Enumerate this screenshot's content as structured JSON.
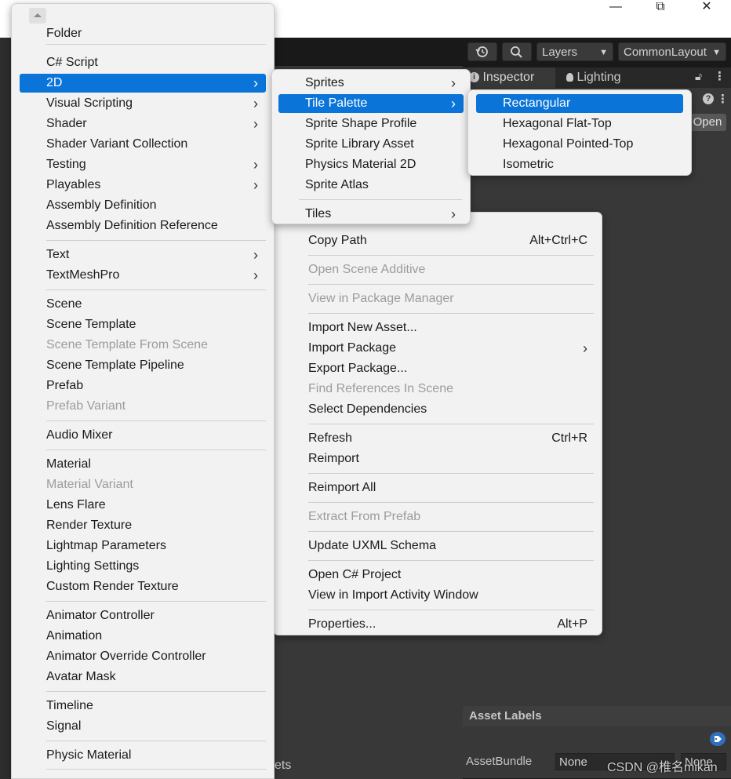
{
  "window": {
    "minimize_glyph": "—",
    "restore_glyph": "⧉",
    "close_glyph": "✕"
  },
  "toolbar": {
    "history_icon": "history-icon",
    "search_icon": "search-icon",
    "layers_label": "Layers",
    "layout_label": "CommonLayout"
  },
  "inspector": {
    "tabs": [
      "Inspector",
      "Lighting"
    ],
    "open_label": "Open",
    "asset_labels_title": "Asset Labels",
    "assetbundle_label": "AssetBundle",
    "assetbundle_value": "None",
    "assetbundle_variant": "None",
    "bottom_partial_text": "ets"
  },
  "create_menu": {
    "items": [
      {
        "label": "Folder"
      },
      {
        "label": "C# Script"
      },
      {
        "label": "2D",
        "submenu": true,
        "selected": true
      },
      {
        "label": "Visual Scripting",
        "submenu": true
      },
      {
        "label": "Shader",
        "submenu": true
      },
      {
        "label": "Shader Variant Collection"
      },
      {
        "label": "Testing",
        "submenu": true
      },
      {
        "label": "Playables",
        "submenu": true
      },
      {
        "label": "Assembly Definition"
      },
      {
        "label": "Assembly Definition Reference"
      },
      {
        "label": "Text",
        "submenu": true
      },
      {
        "label": "TextMeshPro",
        "submenu": true
      },
      {
        "label": "Scene"
      },
      {
        "label": "Scene Template"
      },
      {
        "label": "Scene Template From Scene",
        "disabled": true
      },
      {
        "label": "Scene Template Pipeline"
      },
      {
        "label": "Prefab"
      },
      {
        "label": "Prefab Variant",
        "disabled": true
      },
      {
        "label": "Audio Mixer"
      },
      {
        "label": "Material"
      },
      {
        "label": "Material Variant",
        "disabled": true
      },
      {
        "label": "Lens Flare"
      },
      {
        "label": "Render Texture"
      },
      {
        "label": "Lightmap Parameters"
      },
      {
        "label": "Lighting Settings"
      },
      {
        "label": "Custom Render Texture"
      },
      {
        "label": "Animator Controller"
      },
      {
        "label": "Animation"
      },
      {
        "label": "Animator Override Controller"
      },
      {
        "label": "Avatar Mask"
      },
      {
        "label": "Timeline"
      },
      {
        "label": "Signal"
      },
      {
        "label": "Physic Material"
      }
    ]
  },
  "menu_2d": {
    "items": [
      {
        "label": "Sprites",
        "submenu": true
      },
      {
        "label": "Tile Palette",
        "submenu": true,
        "selected": true
      },
      {
        "label": "Sprite Shape Profile"
      },
      {
        "label": "Sprite Library Asset"
      },
      {
        "label": "Physics Material 2D"
      },
      {
        "label": "Sprite Atlas"
      },
      {
        "label": "Tiles",
        "submenu": true
      }
    ]
  },
  "menu_tile_palette": {
    "items": [
      {
        "label": "Rectangular",
        "selected": true
      },
      {
        "label": "Hexagonal Flat-Top"
      },
      {
        "label": "Hexagonal Pointed-Top"
      },
      {
        "label": "Isometric"
      }
    ]
  },
  "context_menu": {
    "items": [
      {
        "label": "Copy Path",
        "shortcut": "Alt+Ctrl+C"
      },
      {
        "label": "Open Scene Additive",
        "disabled": true
      },
      {
        "label": "View in Package Manager",
        "disabled": true
      },
      {
        "label": "Import New Asset..."
      },
      {
        "label": "Import Package",
        "submenu": true
      },
      {
        "label": "Export Package..."
      },
      {
        "label": "Find References In Scene",
        "disabled": true
      },
      {
        "label": "Select Dependencies"
      },
      {
        "label": "Refresh",
        "shortcut": "Ctrl+R"
      },
      {
        "label": "Reimport"
      },
      {
        "label": "Reimport All"
      },
      {
        "label": "Extract From Prefab",
        "disabled": true
      },
      {
        "label": "Update UXML Schema"
      },
      {
        "label": "Open C# Project"
      },
      {
        "label": "View in Import Activity Window"
      },
      {
        "label": "Properties...",
        "shortcut": "Alt+P"
      }
    ]
  },
  "watermark": "CSDN @椎名mikan"
}
